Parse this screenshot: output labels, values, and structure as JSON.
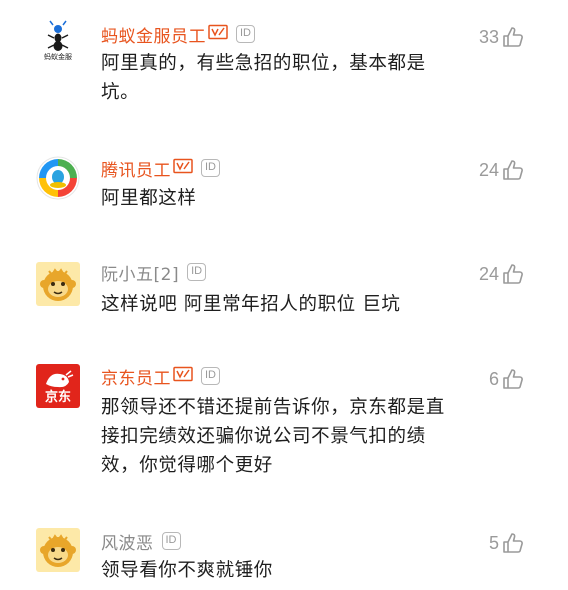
{
  "comments": [
    {
      "name": "蚂蚁金服员工",
      "badge": "ID",
      "likes": "33",
      "text": "阿里真的，有些急招的职位，基本都是坑。",
      "avatar": "ant-financial-logo",
      "avatar_label": "蚂蚁金服"
    },
    {
      "name": "腾讯员工",
      "badge": "ID",
      "likes": "24",
      "text": "阿里都这样",
      "avatar": "tencent-logo"
    },
    {
      "name": "阮小五[2]",
      "badge": "ID",
      "likes": "24",
      "text": "这样说吧 阿里常年招人的职位 巨坑",
      "avatar": "monkey-avatar"
    },
    {
      "name": "京东员工",
      "badge": "ID",
      "likes": "6",
      "text": "那领导还不错还提前告诉你，京东都是直接扣完绩效还骗你说公司不景气扣的绩效，你觉得哪个更好",
      "avatar": "jd-logo",
      "avatar_label": "京东"
    },
    {
      "name": "风波恶",
      "badge": "ID",
      "likes": "5",
      "text": "领导看你不爽就锤你",
      "avatar": "monkey-avatar"
    }
  ],
  "colors": {
    "verified_name": "#e8541e",
    "plain_name": "#8a8a8a",
    "jd_red": "#e1251b"
  }
}
